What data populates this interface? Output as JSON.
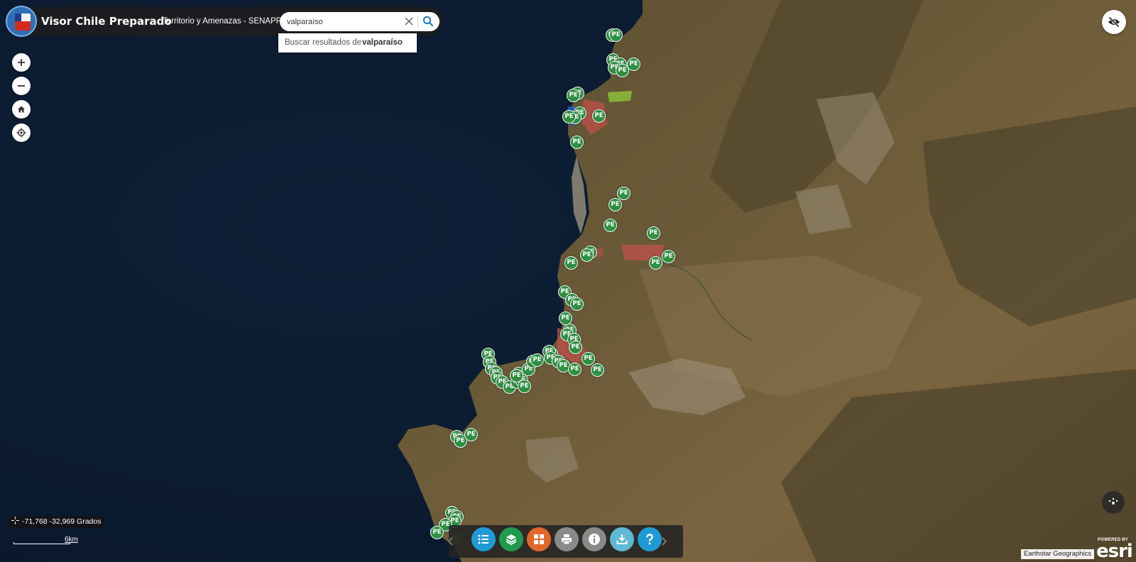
{
  "header": {
    "title": "Visor Chile Preparado",
    "subtitle": "Territorio y Amenazas - SENAPRED"
  },
  "search": {
    "value": "valparaíso",
    "suggestion_prefix": "Buscar resultados de",
    "suggestion_term": "valparaíso"
  },
  "map": {
    "marker_label": "PE",
    "coordinates": "-71,768 -32,969 Grados",
    "scale_label": "6km",
    "attribution": "Earthstar Geographics",
    "esri_powered": "POWERED BY",
    "esri_word": "esri"
  },
  "icons": {
    "zoom_in": "plus-icon",
    "zoom_out": "minus-icon",
    "home": "home-icon",
    "locate": "locate-icon",
    "visibility": "eye-off-icon",
    "compass": "compass-icon",
    "toolbar": [
      "list-icon",
      "layers-icon",
      "grid-icon",
      "print-icon",
      "info-icon",
      "download-icon",
      "help-icon"
    ]
  },
  "colors": {
    "marker": "#2f8f43",
    "toolbar_list": "#1e9ad6",
    "toolbar_layers": "#1f9a4f",
    "toolbar_grid": "#e2672b",
    "toolbar_print": "#8a8a8a",
    "toolbar_info": "#8a8a8a",
    "toolbar_download": "#5fb8d4",
    "toolbar_help": "#1e9ad6"
  }
}
